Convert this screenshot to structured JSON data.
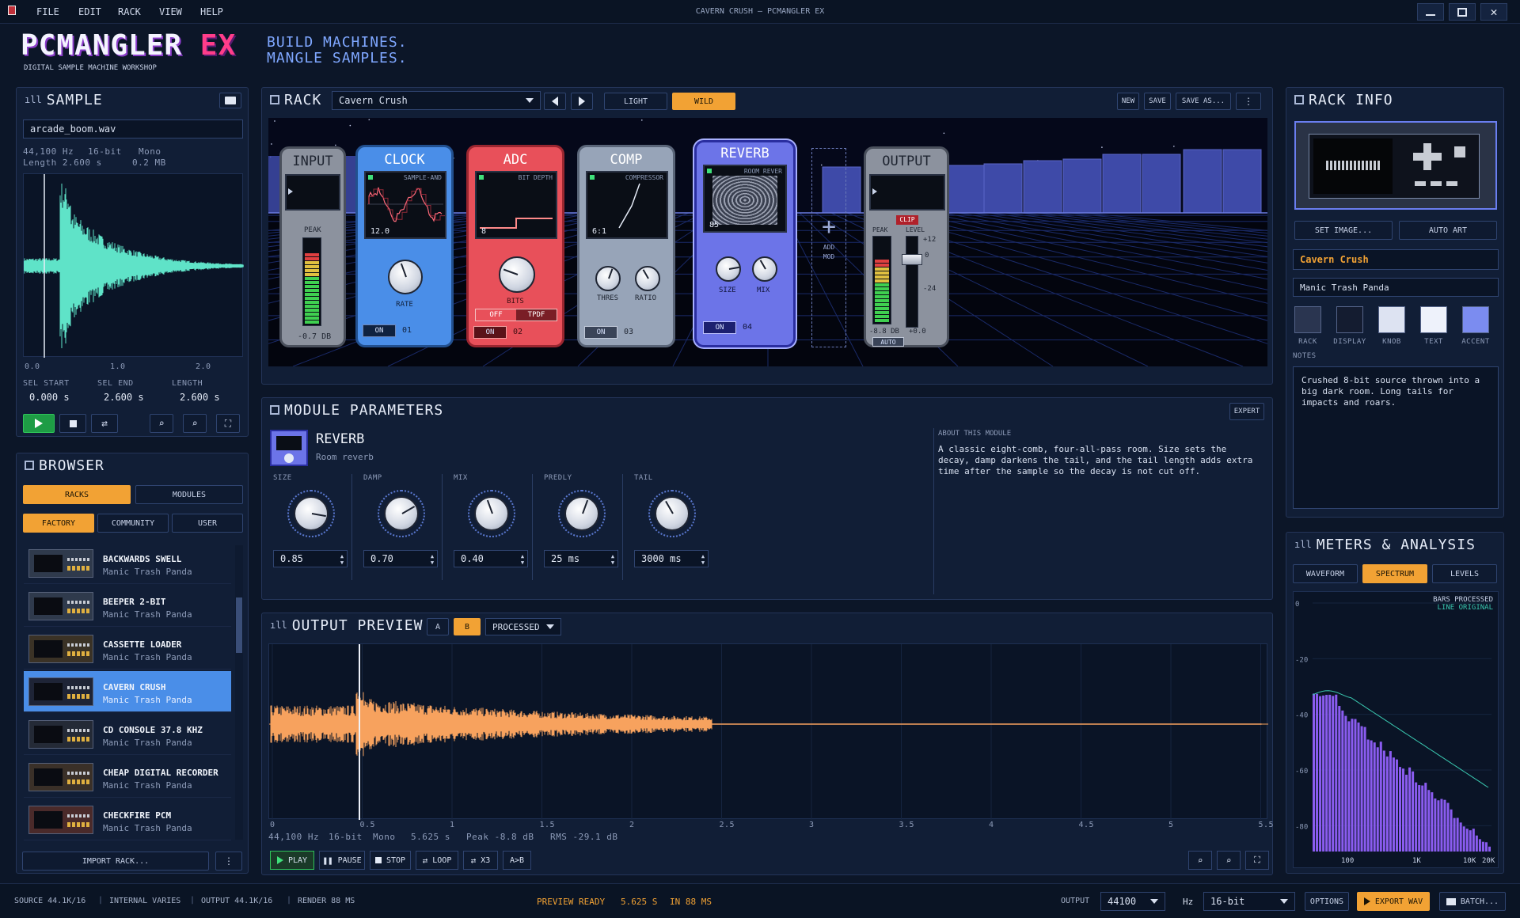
{
  "window": {
    "title": "CAVERN CRUSH – PCMANGLER EX"
  },
  "menu": [
    "FILE",
    "EDIT",
    "RACK",
    "VIEW",
    "HELP"
  ],
  "brand": {
    "logo_a": "PCMANGLER",
    "logo_b": "EX",
    "tagline_small": "DIGITAL SAMPLE MACHINE WORKSHOP",
    "slogan_1": "BUILD MACHINES.",
    "slogan_2": "MANGLE SAMPLES."
  },
  "sample": {
    "title": "SAMPLE",
    "file": "arcade_boom.wav",
    "rate": "44,100 Hz",
    "bits": "16-bit",
    "channels": "Mono",
    "length": "Length 2.600 s",
    "size": "0.2 MB",
    "ticks": [
      "0.0",
      "1.0",
      "2.0"
    ],
    "sel_start_label": "SEL START",
    "sel_start": "0.000 s",
    "sel_end_label": "SEL END",
    "sel_end": "2.600 s",
    "length_label": "LENGTH",
    "length_val": "2.600 s"
  },
  "browser": {
    "title": "BROWSER",
    "tab_racks": "RACKS",
    "tab_modules": "MODULES",
    "filter_factory": "FACTORY",
    "filter_community": "COMMUNITY",
    "filter_user": "USER",
    "items": [
      {
        "name": "BACKWARDS SWELL",
        "author": "Manic Trash Panda"
      },
      {
        "name": "BEEPER 2-BIT",
        "author": "Manic Trash Panda"
      },
      {
        "name": "CASSETTE LOADER",
        "author": "Manic Trash Panda"
      },
      {
        "name": "CAVERN CRUSH",
        "author": "Manic Trash Panda"
      },
      {
        "name": "CD CONSOLE 37.8 KHZ",
        "author": "Manic Trash Panda"
      },
      {
        "name": "CHEAP DIGITAL RECORDER",
        "author": "Manic Trash Panda"
      },
      {
        "name": "CHECKFIRE PCM",
        "author": "Manic Trash Panda"
      }
    ],
    "import": "IMPORT RACK..."
  },
  "rack": {
    "title": "RACK",
    "preset": "Cavern Crush",
    "mode_light": "LIGHT",
    "mode_wild": "WILD",
    "new": "NEW",
    "save": "SAVE",
    "save_as": "SAVE AS...",
    "input": {
      "title": "INPUT",
      "peak": "PEAK",
      "db": "-0.7 DB"
    },
    "clock": {
      "title": "CLOCK",
      "sub": "SAMPLE-AND",
      "val": "12.0",
      "knob": "RATE",
      "on": "ON",
      "num": "01"
    },
    "adc": {
      "title": "ADC",
      "sub": "BIT DEPTH",
      "val": "8",
      "knob": "BITS",
      "off": "OFF",
      "tpdf": "TPDF",
      "on": "ON",
      "num": "02"
    },
    "comp": {
      "title": "COMP",
      "sub": "COMPRESSOR",
      "val": "6:1",
      "knob1": "THRES",
      "knob2": "RATIO",
      "on": "ON",
      "num": "03"
    },
    "reverb": {
      "title": "REVERB",
      "sub": "ROOM REVER",
      "val": "85",
      "knob1": "SIZE",
      "knob2": "MIX",
      "on": "ON",
      "num": "04"
    },
    "add": {
      "l1": "ADD",
      "l2": "MOD"
    },
    "output": {
      "title": "OUTPUT",
      "clip": "CLIP",
      "peak": "PEAK",
      "level": "LEVEL",
      "s12": "+12",
      "s0": "0",
      "s24": "-24",
      "s00": "+0.0",
      "db": "-8.8 DB",
      "auto": "AUTO"
    }
  },
  "params": {
    "title": "MODULE PARAMETERS",
    "expert": "EXPERT",
    "module": "REVERB",
    "module_sub": "Room reverb",
    "about_label": "ABOUT THIS MODULE",
    "about": "A classic eight-comb, four-all-pass room. Size sets the decay, damp darkens the tail, and the tail length adds extra time after the sample so the decay is not cut off.",
    "items": [
      {
        "label": "SIZE",
        "value": "0.85"
      },
      {
        "label": "DAMP",
        "value": "0.70"
      },
      {
        "label": "MIX",
        "value": "0.40"
      },
      {
        "label": "PREDLY",
        "value": "25 ms"
      },
      {
        "label": "TAIL",
        "value": "3000 ms"
      }
    ]
  },
  "preview": {
    "title": "OUTPUT PREVIEW",
    "a": "A",
    "b": "B",
    "mode": "PROCESSED",
    "ticks": [
      "0",
      "0.5",
      "1",
      "1.5",
      "2",
      "2.5",
      "3",
      "3.5",
      "4",
      "4.5",
      "5",
      "5.5"
    ],
    "rate": "44,100 Hz",
    "bits": "16-bit",
    "ch": "Mono",
    "dur": "5.625 s",
    "peak": "Peak -8.8 dB",
    "rms": "RMS -29.1 dB",
    "play": "PLAY",
    "pause": "PAUSE",
    "stop": "STOP",
    "loop": "LOOP",
    "x3": "X3",
    "ab": "A>B"
  },
  "rackinfo": {
    "title": "RACK INFO",
    "set_image": "SET IMAGE...",
    "auto_art": "AUTO ART",
    "name": "Cavern Crush",
    "author": "Manic Trash Panda",
    "swatches": [
      {
        "label": "RACK",
        "color": "#2a3550"
      },
      {
        "label": "DISPLAY",
        "color": "#141c30"
      },
      {
        "label": "KNOB",
        "color": "#dde3f2"
      },
      {
        "label": "TEXT",
        "color": "#eef2fb"
      },
      {
        "label": "ACCENT",
        "color": "#7b8cf0"
      }
    ],
    "notes_label": "NOTES",
    "notes": "Crushed 8-bit source thrown into a big dark room. Long tails for impacts and roars."
  },
  "meters": {
    "title": "METERS & ANALYSIS",
    "tab_waveform": "WAVEFORM",
    "tab_spectrum": "SPECTRUM",
    "tab_levels": "LEVELS",
    "legend_bars": "BARS PROCESSED",
    "legend_line": "LINE ORIGINAL",
    "y_ticks": [
      "0",
      "-20",
      "-40",
      "-60",
      "-80"
    ],
    "x_ticks": [
      "100",
      "1K",
      "10K",
      "20K"
    ]
  },
  "status": {
    "source": "SOURCE 44.1K/16",
    "internal": "INTERNAL VARIES",
    "output": "OUTPUT 44.1K/16",
    "render": "RENDER 88 MS",
    "ready": "PREVIEW READY",
    "ready_dur": "5.625 S",
    "ready_in": "IN 88 MS",
    "output_label": "OUTPUT",
    "rate": "44100",
    "hz": "Hz",
    "bits": "16-bit",
    "options": "OPTIONS",
    "export": "EXPORT WAV",
    "batch": "BATCH..."
  },
  "colors": {
    "accent": "#f2a234",
    "wave_src": "#5fe3c8",
    "wave_out": "#f7a25e",
    "spectrum": "#8a5cf0"
  }
}
